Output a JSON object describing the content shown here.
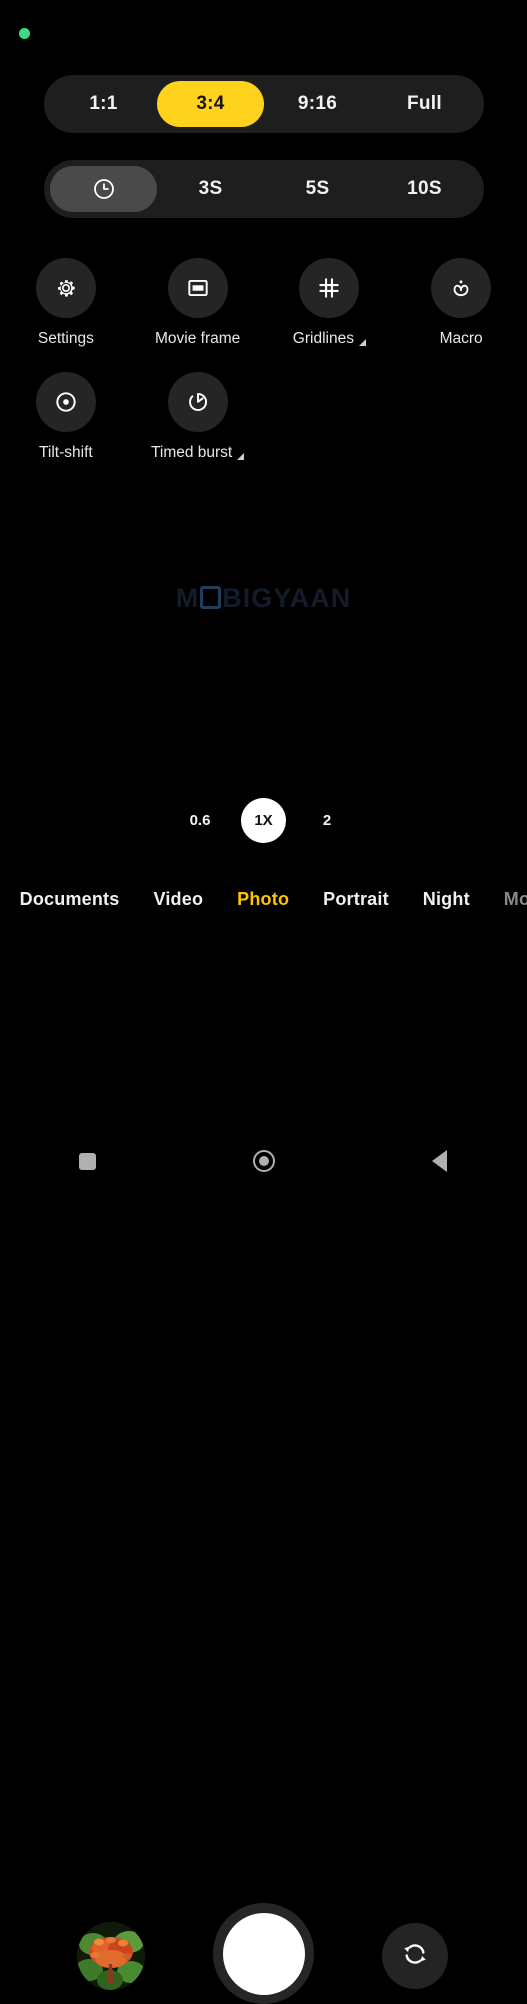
{
  "status": {
    "privacy_indicator": "camera-in-use-dot",
    "privacy_color": "#3ddc84"
  },
  "aspect_ratio": {
    "name": "aspect-ratio-selector",
    "selected": "3:4",
    "options": [
      {
        "label": "1:1",
        "selected": false
      },
      {
        "label": "3:4",
        "selected": true
      },
      {
        "label": "9:16",
        "selected": false
      },
      {
        "label": "Full",
        "selected": false
      }
    ]
  },
  "timer": {
    "name": "timer-selector",
    "selected": "off",
    "options": [
      {
        "label": "",
        "icon": "clock-icon",
        "selected": true
      },
      {
        "label": "3S",
        "icon": "",
        "selected": false
      },
      {
        "label": "5S",
        "icon": "",
        "selected": false
      },
      {
        "label": "10S",
        "icon": "",
        "selected": false
      }
    ]
  },
  "features": [
    {
      "label": "Settings",
      "icon": "gear-icon",
      "expandable": false
    },
    {
      "label": "Movie frame",
      "icon": "movie-frame-icon",
      "expandable": false
    },
    {
      "label": "Gridlines",
      "icon": "gridlines-icon",
      "expandable": true
    },
    {
      "label": "Macro",
      "icon": "macro-flower-icon",
      "expandable": false
    },
    {
      "label": "Tilt-shift",
      "icon": "tilt-shift-icon",
      "expandable": false
    },
    {
      "label": "Timed burst",
      "icon": "timed-burst-icon",
      "expandable": true
    }
  ],
  "watermark": {
    "text_before": "M",
    "text_after": "BIGYAAN",
    "full_text": "MOBIGYAAN",
    "color": "#121d29"
  },
  "zoom": {
    "name": "zoom-level-selector",
    "selected": "1X",
    "levels": [
      {
        "label": "0.6",
        "selected": false
      },
      {
        "label": "1X",
        "selected": true
      },
      {
        "label": "2",
        "selected": false
      }
    ]
  },
  "modes": {
    "name": "camera-mode-selector",
    "selected": "Photo",
    "accent": "#ffc400",
    "items": [
      {
        "label": ")",
        "state": "edge"
      },
      {
        "label": "Documents",
        "state": "normal"
      },
      {
        "label": "Video",
        "state": "normal"
      },
      {
        "label": "Photo",
        "state": "active"
      },
      {
        "label": "Portrait",
        "state": "normal"
      },
      {
        "label": "Night",
        "state": "normal"
      },
      {
        "label": "More",
        "state": "edge"
      }
    ]
  },
  "actions": {
    "gallery_thumbnail": "flower-photo-thumbnail",
    "shutter": "shutter-button",
    "flip": "flip-camera-icon"
  },
  "navigation": {
    "recents": "recents-square-icon",
    "home": "home-circle-icon",
    "back": "back-triangle-icon"
  }
}
